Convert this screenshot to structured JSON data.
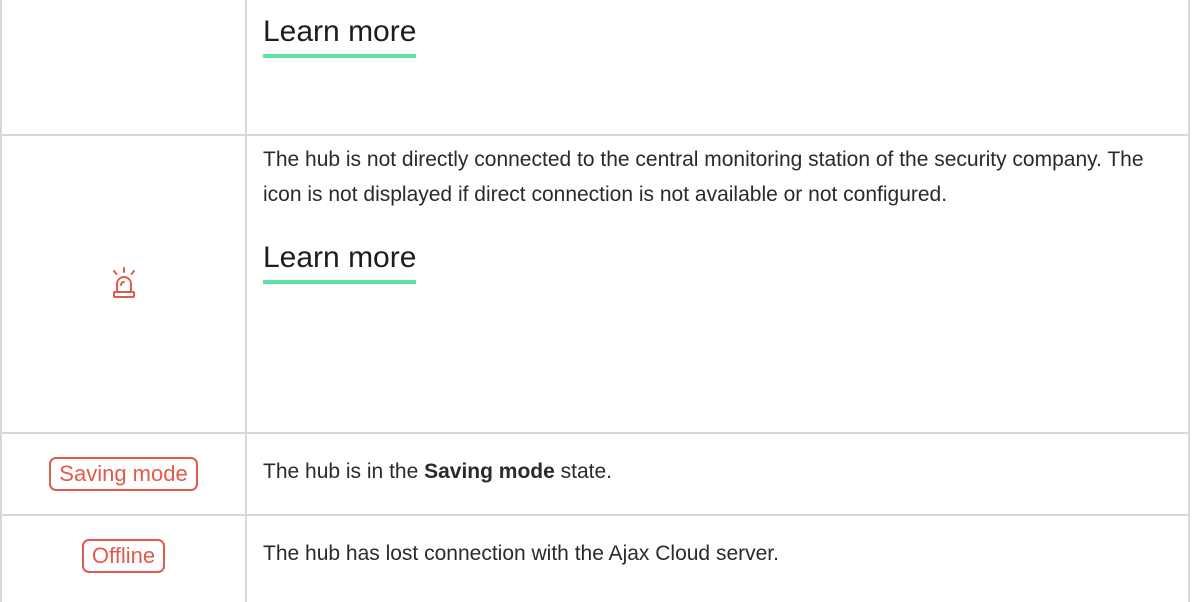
{
  "rows": [
    {
      "link": "Learn more"
    },
    {
      "icon": "siren-alarm-icon",
      "description": "The hub is not directly connected to the central monitoring station of the security company. The icon is not displayed if direct connection is not available or not configured.",
      "link": "Learn more"
    },
    {
      "badge": "Saving mode",
      "text_before": "The hub is in the ",
      "text_bold": "Saving mode",
      "text_after": " state."
    },
    {
      "badge": "Offline",
      "description": "The hub has lost connection with the Ajax Cloud server."
    }
  ],
  "colors": {
    "accent_red": "#e25a4e",
    "link_underline": "#5ee0a0",
    "border": "#d7d7d7"
  }
}
